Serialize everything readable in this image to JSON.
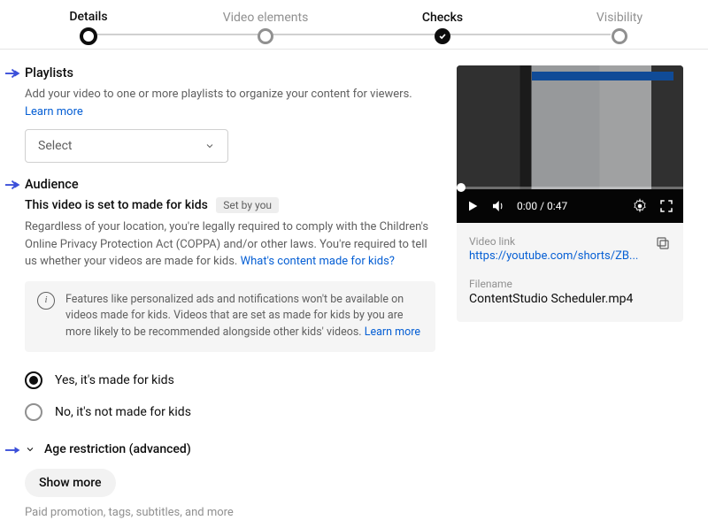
{
  "stepper": {
    "steps": [
      {
        "label": "Details",
        "state": "current"
      },
      {
        "label": "Video elements",
        "state": "pending"
      },
      {
        "label": "Checks",
        "state": "done"
      },
      {
        "label": "Visibility",
        "state": "pending"
      }
    ]
  },
  "playlists": {
    "title": "Playlists",
    "description": "Add your video to one or more playlists to organize your content for viewers.",
    "learn_more": "Learn more",
    "select_placeholder": "Select"
  },
  "audience": {
    "title": "Audience",
    "sub_title": "This video is set to made for kids",
    "badge": "Set by you",
    "body": "Regardless of your location, you're legally required to comply with the Children's Online Privacy Protection Act (COPPA) and/or other laws. You're required to tell us whether your videos are made for kids.",
    "body_link": "What's content made for kids?",
    "info_text": "Features like personalized ads and notifications won't be available on videos made for kids. Videos that are set as made for kids by you are more likely to be recommended alongside other kids' videos.",
    "info_link": "Learn more",
    "radio_yes": "Yes, it's made for kids",
    "radio_no": "No, it's not made for kids"
  },
  "age_restriction": {
    "label": "Age restriction (advanced)"
  },
  "show_more": {
    "button": "Show more",
    "hint": "Paid promotion, tags, subtitles, and more"
  },
  "preview": {
    "time": "0:00 / 0:47",
    "video_link_label": "Video link",
    "video_link": "https://youtube.com/shorts/ZB...",
    "filename_label": "Filename",
    "filename": "ContentStudio Scheduler.mp4"
  }
}
